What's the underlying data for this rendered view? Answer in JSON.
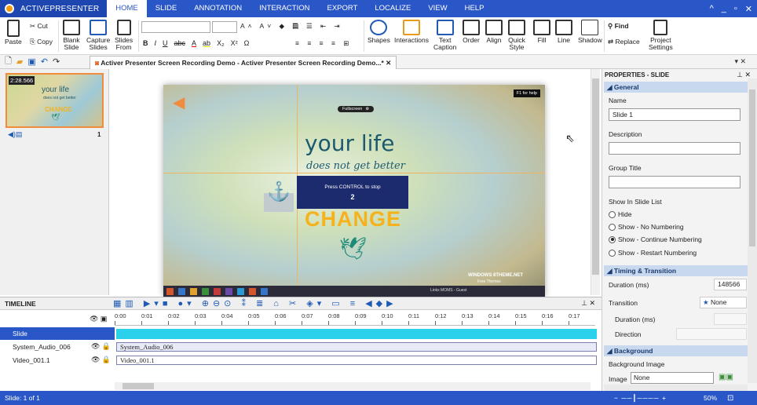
{
  "app": {
    "name": "ACTIVEPRESENTER"
  },
  "menu": [
    "HOME",
    "SLIDE",
    "ANNOTATION",
    "INTERACTION",
    "EXPORT",
    "LOCALIZE",
    "VIEW",
    "HELP"
  ],
  "window_controls": [
    "^",
    "_",
    "▫",
    "✕"
  ],
  "ribbon": {
    "paste": "Paste",
    "cut": "Cut",
    "copy": "Copy",
    "blank_slide": [
      "Blank",
      "Slide"
    ],
    "capture_slides": [
      "Capture",
      "Slides"
    ],
    "slides_from": [
      "Slides",
      "From"
    ],
    "shapes": "Shapes",
    "interactions": "Interactions",
    "text_caption": [
      "Text",
      "Caption"
    ],
    "order": "Order",
    "align": "Align",
    "quick_style": [
      "Quick",
      "Style"
    ],
    "fill": "Fill",
    "line": "Line",
    "shadow": "Shadow",
    "find": "Find",
    "replace": "Replace",
    "project_settings": [
      "Project",
      "Settings"
    ],
    "format_buttons": [
      "B",
      "I",
      "U",
      "abc",
      "A",
      "ab",
      "X₂",
      "X²",
      "Ω"
    ]
  },
  "document_tab": "Activer Presenter Screen Recording Demo - Activer Presenter Screen Recording Demo...*",
  "thumbnail": {
    "time": "2:28.566",
    "number": "1",
    "title": "your life",
    "sub": "does not get better",
    "word": "CHANGE"
  },
  "slide": {
    "title": "your life",
    "subtitle": "does not get better",
    "word": "CHANGE",
    "fullscreen": "Fullscreen",
    "help": "F1 for help",
    "overlay_line": "Press CONTROL to stop",
    "overlay_count": "2",
    "watermark_1": "WINDOWS 8THEME.NET",
    "watermark_2": "Free Themes",
    "taskbar_text": "Links   MOMS - Guest"
  },
  "properties": {
    "header": "PROPERTIES - SLIDE",
    "general": "General",
    "name_label": "Name",
    "name_value": "Slide 1",
    "description_label": "Description",
    "group_title_label": "Group Title",
    "show_in_list_label": "Show In Slide List",
    "radios": [
      "Hide",
      "Show - No Numbering",
      "Show - Continue Numbering",
      "Show - Restart Numbering"
    ],
    "selected_radio": 2,
    "timing": "Timing & Transition",
    "duration_label": "Duration (ms)",
    "duration_value": "148566",
    "transition_label": "Transition",
    "transition_value": "None",
    "t_duration_label": "Duration (ms)",
    "direction_label": "Direction",
    "background": "Background",
    "bg_image_label": "Background Image",
    "image_label": "Image",
    "image_value": "None"
  },
  "timeline": {
    "title": "TIMELINE",
    "ticks": [
      "0:00",
      "0:01",
      "0:02",
      "0:03",
      "0:04",
      "0:05",
      "0:06",
      "0:07",
      "0:08",
      "0:09",
      "0:10",
      "0:11",
      "0:12",
      "0:13",
      "0:14",
      "0:15",
      "0:16",
      "0:17"
    ],
    "tracks": [
      {
        "name": "Slide",
        "clip": ""
      },
      {
        "name": "System_Audio_006",
        "clip": "System_Audio_006"
      },
      {
        "name": "Video_001.1",
        "clip": "Video_001.1"
      }
    ]
  },
  "status": {
    "left": "Slide: 1 of 1",
    "zoom": "50%"
  },
  "colors": {
    "menubar": "#2a57c7",
    "accent_orange": "#f08c3c",
    "title_teal": "#1e5a6e",
    "change_yellow": "#f5b21c"
  }
}
